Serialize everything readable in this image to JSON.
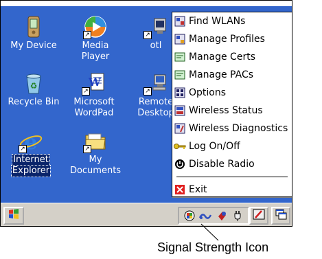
{
  "desktop": {
    "icons": [
      {
        "label_line1": "My Device",
        "label_line2": ""
      },
      {
        "label_line1": "Media",
        "label_line2": "Player"
      },
      {
        "label_line1": "otl",
        "label_line2": ""
      },
      {
        "label_line1": "Recycle Bin",
        "label_line2": ""
      },
      {
        "label_line1": "Microsoft",
        "label_line2": "WordPad"
      },
      {
        "label_line1": "Remote",
        "label_line2": "Desktop"
      },
      {
        "label_line1": "Internet",
        "label_line2": "Explorer"
      },
      {
        "label_line1": "My",
        "label_line2": "Documents"
      }
    ]
  },
  "menu": {
    "items": [
      {
        "label": "Find WLANs",
        "icon": "find-wlans-icon"
      },
      {
        "label": "Manage Profiles",
        "icon": "manage-profiles-icon"
      },
      {
        "label": "Manage Certs",
        "icon": "manage-certs-icon"
      },
      {
        "label": "Manage PACs",
        "icon": "manage-pacs-icon"
      },
      {
        "label": "Options",
        "icon": "options-icon"
      },
      {
        "label": "Wireless Status",
        "icon": "wireless-status-icon"
      },
      {
        "label": "Wireless Diagnostics",
        "icon": "wireless-diagnostics-icon"
      },
      {
        "label": "Log On/Off",
        "icon": "key-icon"
      },
      {
        "label": "Disable Radio",
        "icon": "power-icon"
      }
    ],
    "exit_label": "Exit"
  },
  "taskbar": {
    "start_icon": "windows-logo-icon",
    "tray_icons": [
      "network-icon",
      "signal-strength-icon",
      "volume-icon",
      "power-plug-icon"
    ]
  },
  "callout": {
    "label": "Signal Strength Icon"
  },
  "colors": {
    "desktop": "#3366cc",
    "taskbar": "#d4d0c8",
    "selection": "#0a246a",
    "exit_red": "#e02020"
  }
}
